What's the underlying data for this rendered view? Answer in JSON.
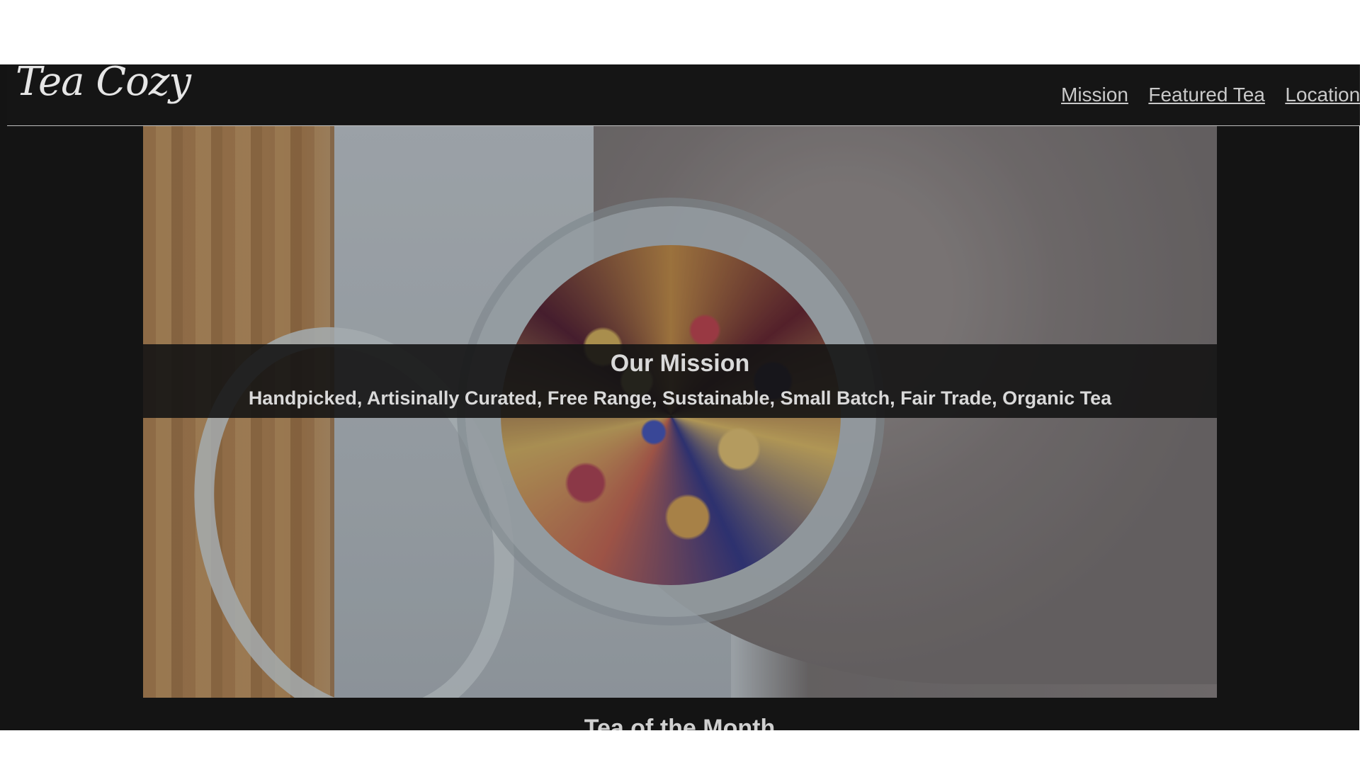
{
  "header": {
    "logo": "Tea Cozy",
    "nav": [
      {
        "label": "Mission"
      },
      {
        "label": "Featured Tea"
      },
      {
        "label": "Locations"
      }
    ]
  },
  "hero": {
    "image_alt": "tea leaves in a glass jar",
    "mission_title": "Our Mission",
    "mission_text": "Handpicked, Artisinally Curated, Free Range, Sustainable, Small Batch, Fair Trade, Organic Tea"
  },
  "next_section": {
    "title": "Tea of the Month"
  }
}
